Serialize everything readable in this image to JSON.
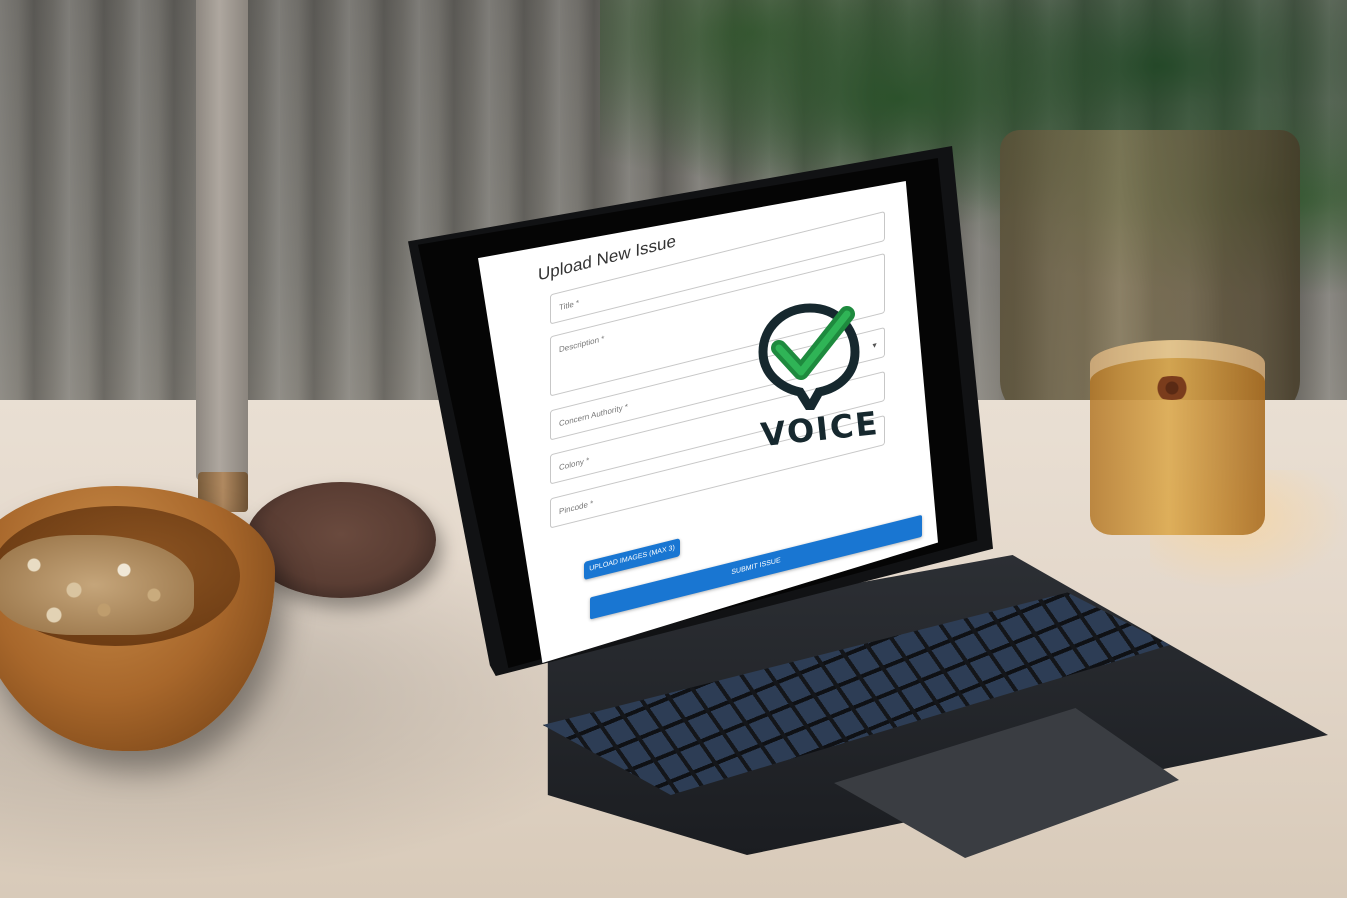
{
  "form": {
    "title": "Upload New Issue",
    "fields": [
      {
        "label": "Title *"
      },
      {
        "label": "Description *"
      },
      {
        "label": "Concern Authority *"
      },
      {
        "label": "Colony *"
      },
      {
        "label": "Pincode *"
      }
    ],
    "upload_button": "UPLOAD IMAGES (MAX 3)",
    "submit_button": "SUBMIT ISSUE"
  },
  "logo": {
    "text": "VOICE",
    "icon": "checkmark-location-pin-icon",
    "accent_color": "#1e8a3e",
    "dark_color": "#16282e"
  },
  "colors": {
    "primary_button": "#1976d2"
  }
}
